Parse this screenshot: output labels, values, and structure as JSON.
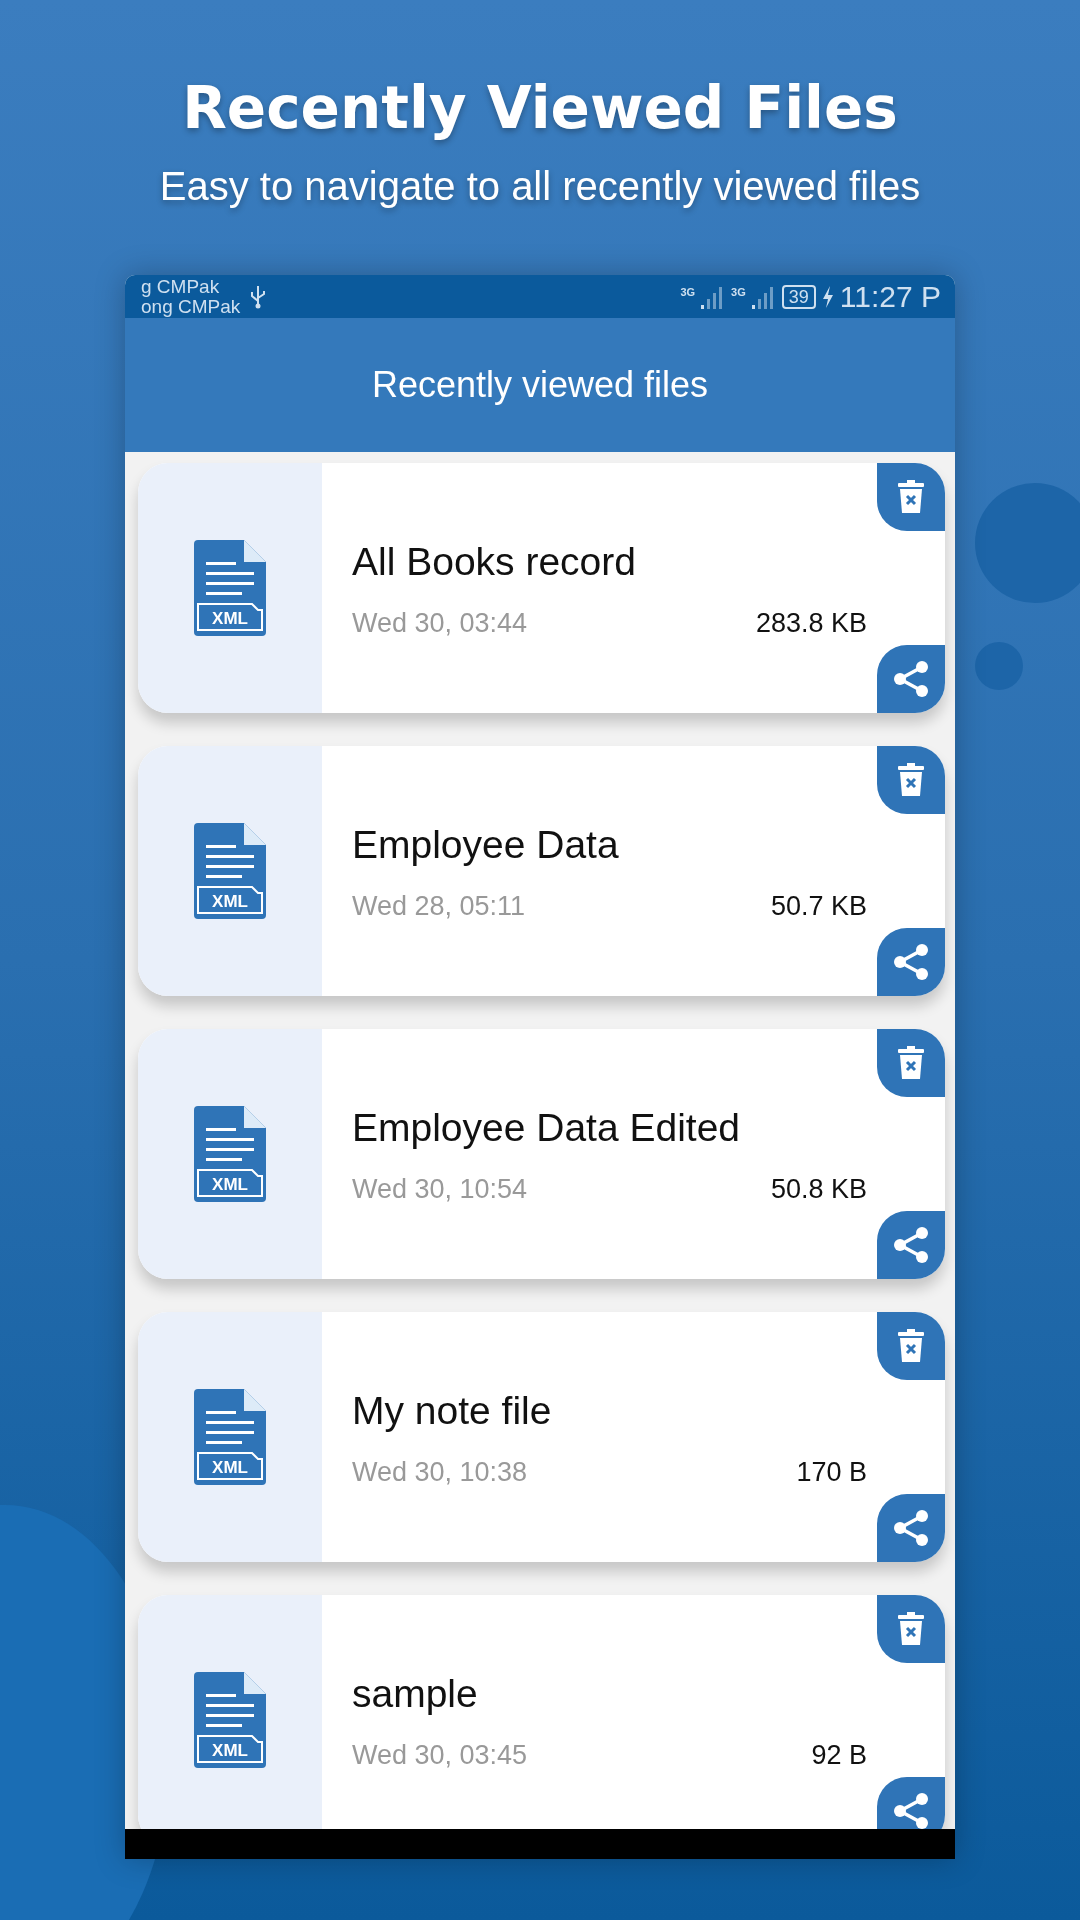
{
  "promo": {
    "headline": "Recently Viewed Files",
    "subtitle": "Easy to navigate to all recently viewed files"
  },
  "status_bar": {
    "carrier_1": "g CMPak",
    "carrier_2": "ong CMPak",
    "network_1": "3G",
    "network_2": "3G",
    "battery": "39",
    "time": "11:27 P"
  },
  "app_bar": {
    "title": "Recently viewed files"
  },
  "files": [
    {
      "name": "All Books record",
      "date": "Wed 30, 03:44",
      "size": "283.8 KB",
      "type_label": "XML"
    },
    {
      "name": "Employee Data",
      "date": "Wed 28, 05:11",
      "size": "50.7 KB",
      "type_label": "XML"
    },
    {
      "name": "Employee Data Edited",
      "date": "Wed 30, 10:54",
      "size": "50.8 KB",
      "type_label": "XML"
    },
    {
      "name": "My note file",
      "date": "Wed 30, 10:38",
      "size": "170 B",
      "type_label": "XML"
    },
    {
      "name": "sample",
      "date": "Wed 30, 03:45",
      "size": "92 B",
      "type_label": "XML"
    }
  ]
}
